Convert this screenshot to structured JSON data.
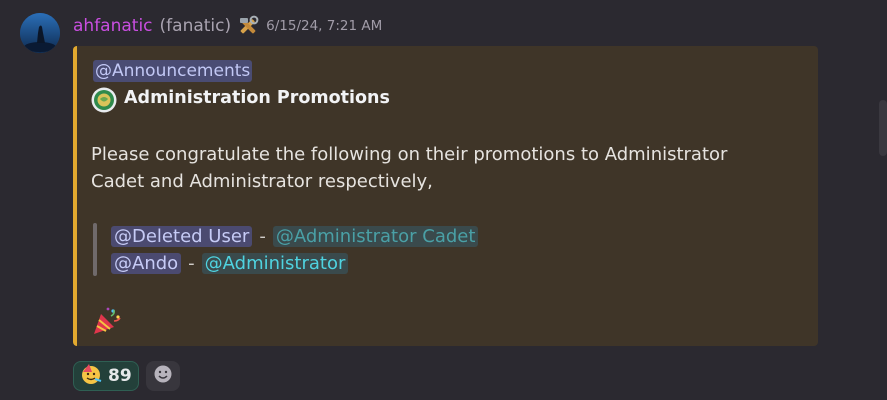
{
  "message": {
    "username": "ahfanatic",
    "tag": "(fanatic)",
    "badge_icon": "hammer-wrench-icon",
    "timestamp": "6/15/24, 7:21 AM",
    "username_color": "#c94ee0"
  },
  "embed": {
    "accent_color": "#e2a92f",
    "mention": "@Announcements",
    "title_icon": "globe-emblem-icon",
    "title": "Administration Promotions",
    "body_line1": "Please congratulate the following on their promotions to Administrator",
    "body_line2": "Cadet and Administrator respectively,",
    "quote": [
      {
        "user": "@Deleted User",
        "separator": "-",
        "role": "@Administrator Cadet",
        "role_color": "#4aa0a6"
      },
      {
        "user": "@Ando",
        "separator": "-",
        "role": "@Administrator",
        "role_color": "#4fd3e0"
      }
    ],
    "footer_emoji": "party-popper-icon"
  },
  "reactions": [
    {
      "emoji": "partying-face-icon",
      "count": "89"
    }
  ],
  "add_reaction_icon": "smiley-icon"
}
